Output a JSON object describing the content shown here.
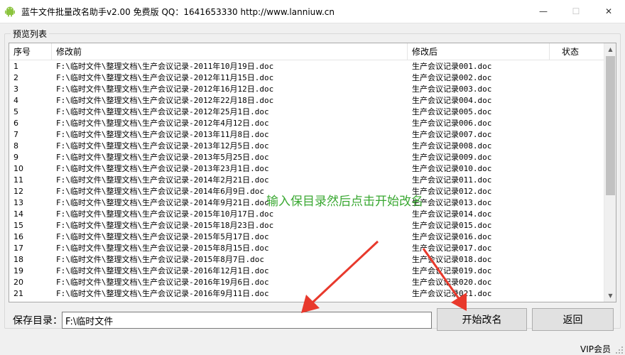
{
  "window": {
    "title": "蓝牛文件批量改名助手v2.00 免费版 QQ：1641653330   http://www.lanniuw.cn",
    "minimize_glyph": "—",
    "maximize_glyph": "☐",
    "close_glyph": "✕"
  },
  "group": {
    "label": "预览列表"
  },
  "table": {
    "columns": [
      "序号",
      "修改前",
      "修改后",
      "状态"
    ],
    "rows": [
      [
        "1",
        "F:\\临时文件\\整理文档\\生产会议记录-2011年10月19日.doc",
        "生产会议记录001.doc",
        ""
      ],
      [
        "2",
        "F:\\临时文件\\整理文档\\生产会议记录-2012年11月15日.doc",
        "生产会议记录002.doc",
        ""
      ],
      [
        "3",
        "F:\\临时文件\\整理文档\\生产会议记录-2012年16月12日.doc",
        "生产会议记录003.doc",
        ""
      ],
      [
        "4",
        "F:\\临时文件\\整理文档\\生产会议记录-2012年22月18日.doc",
        "生产会议记录004.doc",
        ""
      ],
      [
        "5",
        "F:\\临时文件\\整理文档\\生产会议记录-2012年25月1日.doc",
        "生产会议记录005.doc",
        ""
      ],
      [
        "6",
        "F:\\临时文件\\整理文档\\生产会议记录-2012年4月12日.doc",
        "生产会议记录006.doc",
        ""
      ],
      [
        "7",
        "F:\\临时文件\\整理文档\\生产会议记录-2013年11月8日.doc",
        "生产会议记录007.doc",
        ""
      ],
      [
        "8",
        "F:\\临时文件\\整理文档\\生产会议记录-2013年12月5日.doc",
        "生产会议记录008.doc",
        ""
      ],
      [
        "9",
        "F:\\临时文件\\整理文档\\生产会议记录-2013年5月25日.doc",
        "生产会议记录009.doc",
        ""
      ],
      [
        "10",
        "F:\\临时文件\\整理文档\\生产会议记录-2013年23月1日.doc",
        "生产会议记录010.doc",
        ""
      ],
      [
        "11",
        "F:\\临时文件\\整理文档\\生产会议记录-2014年2月21日.doc",
        "生产会议记录011.doc",
        ""
      ],
      [
        "12",
        "F:\\临时文件\\整理文档\\生产会议记录-2014年6月9日.doc",
        "生产会议记录012.doc",
        ""
      ],
      [
        "13",
        "F:\\临时文件\\整理文档\\生产会议记录-2014年9月21日.doc",
        "生产会议记录013.doc",
        ""
      ],
      [
        "14",
        "F:\\临时文件\\整理文档\\生产会议记录-2015年10月17日.doc",
        "生产会议记录014.doc",
        ""
      ],
      [
        "15",
        "F:\\临时文件\\整理文档\\生产会议记录-2015年18月23日.doc",
        "生产会议记录015.doc",
        ""
      ],
      [
        "16",
        "F:\\临时文件\\整理文档\\生产会议记录-2015年5月17日.doc",
        "生产会议记录016.doc",
        ""
      ],
      [
        "17",
        "F:\\临时文件\\整理文档\\生产会议记录-2015年8月15日.doc",
        "生产会议记录017.doc",
        ""
      ],
      [
        "18",
        "F:\\临时文件\\整理文档\\生产会议记录-2015年8月7日.doc",
        "生产会议记录018.doc",
        ""
      ],
      [
        "19",
        "F:\\临时文件\\整理文档\\生产会议记录-2016年12月1日.doc",
        "生产会议记录019.doc",
        ""
      ],
      [
        "20",
        "F:\\临时文件\\整理文档\\生产会议记录-2016年19月6日.doc",
        "生产会议记录020.doc",
        ""
      ],
      [
        "21",
        "F:\\临时文件\\整理文档\\生产会议记录-2016年9月11日.doc",
        "生产会议记录021.doc",
        ""
      ]
    ]
  },
  "annotation": {
    "text": "输入保目录然后点击开始改名",
    "color": "#3aa832",
    "arrow_color": "#e8392c"
  },
  "save": {
    "label": "保存目录：",
    "value": "F:\\临时文件"
  },
  "buttons": {
    "start": "开始改名",
    "back": "返回"
  },
  "status": {
    "vip": "VIP会员"
  }
}
